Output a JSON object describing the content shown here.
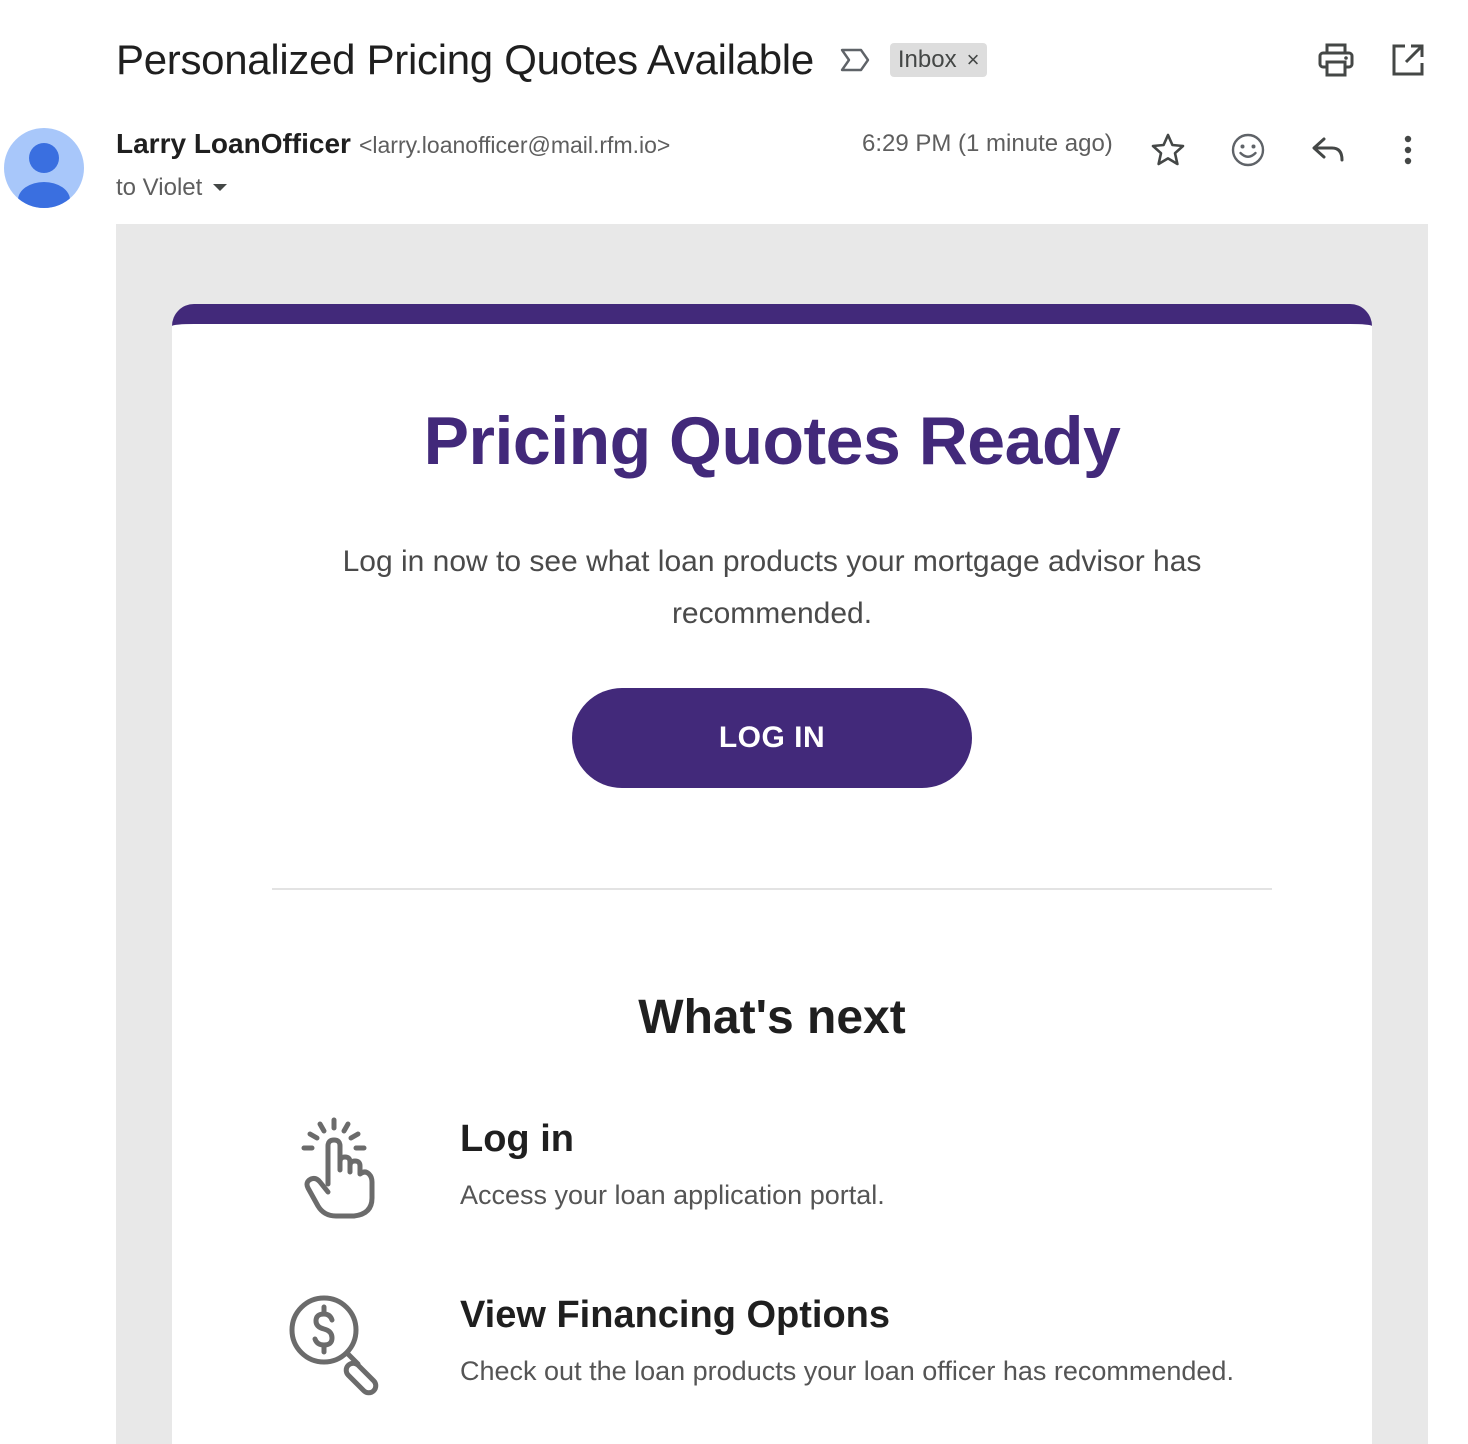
{
  "header": {
    "subject": "Personalized Pricing Quotes Available",
    "label_chip": "Inbox",
    "label_chip_close": "×",
    "important_marker_icon": "important-marker-icon",
    "print_icon": "print-icon",
    "new_window_icon": "open-in-new-window-icon"
  },
  "message": {
    "sender_name": "Larry LoanOfficer",
    "sender_email": "<larry.loanofficer@mail.rfm.io>",
    "recipient": "to Violet",
    "timestamp": "6:29 PM (1 minute ago)",
    "actions": [
      "star-icon",
      "emoji-reaction-icon",
      "reply-icon",
      "more-vert-icon"
    ]
  },
  "email": {
    "accent_color": "#42297a",
    "background_color": "#e8e8e8",
    "hero_title": "Pricing Quotes Ready",
    "hero_text": "Log in now to see what loan products your mortgage advisor has recommended.",
    "cta_label": "LOG IN",
    "next_title": "What's next",
    "steps": [
      {
        "icon": "tap-hand-icon",
        "title": "Log in",
        "description": "Access your loan application portal."
      },
      {
        "icon": "dollar-search-icon",
        "title": "View Financing Options",
        "description": "Check out the loan products your loan officer has recommended."
      }
    ]
  }
}
